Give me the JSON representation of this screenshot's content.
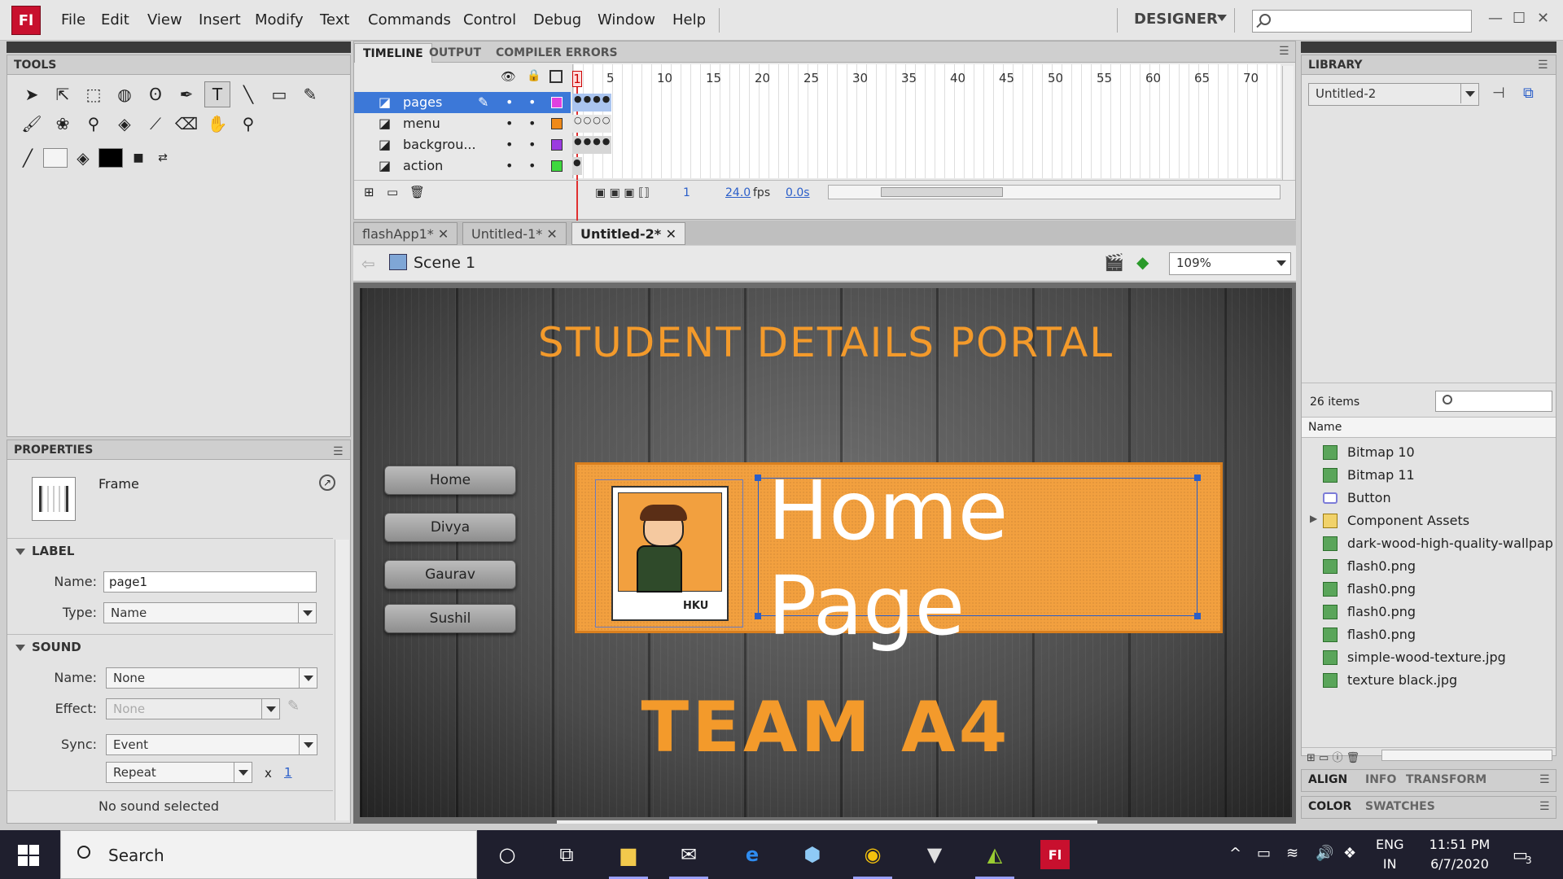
{
  "app": {
    "logo": "Fl",
    "workspace": "DESIGNER"
  },
  "menu": [
    "File",
    "Edit",
    "View",
    "Insert",
    "Modify",
    "Text",
    "Commands",
    "Control",
    "Debug",
    "Window",
    "Help"
  ],
  "panels": {
    "tools": "TOOLS",
    "properties": "PROPERTIES",
    "library": "LIBRARY"
  },
  "properties": {
    "type_label": "Frame",
    "label_section": "LABEL",
    "name_label": "Name:",
    "name_value": "page1",
    "type_field_label": "Type:",
    "type_value": "Name",
    "sound_section": "SOUND",
    "sound_name_label": "Name:",
    "sound_name_value": "None",
    "effect_label": "Effect:",
    "effect_value": "None",
    "sync_label": "Sync:",
    "sync_value": "Event",
    "repeat_value": "Repeat",
    "repeat_x": "x",
    "repeat_count": "1",
    "status": "No sound selected"
  },
  "timeline": {
    "tabs": [
      "TIMELINE",
      "OUTPUT",
      "COMPILER ERRORS"
    ],
    "layers": [
      "pages",
      "menu",
      "backgrou...",
      "action"
    ],
    "layer_colors": [
      "#e040e0",
      "#f08a1a",
      "#9b3ce0",
      "#3ed83e"
    ],
    "frame_numbers": [
      "1",
      "5",
      "10",
      "15",
      "20",
      "25",
      "30",
      "35",
      "40",
      "45",
      "50",
      "55",
      "60",
      "65",
      "70"
    ],
    "current_frame": "1",
    "fps": "24.0",
    "fps_unit": "fps",
    "time": "0.0s"
  },
  "documents": [
    "flashApp1*",
    "Untitled-1*",
    "Untitled-2*"
  ],
  "scene": {
    "name": "Scene 1",
    "zoom": "109%"
  },
  "stage": {
    "title": "STUDENT DETAILS PORTAL",
    "buttons": [
      "Home",
      "Divya",
      "Gaurav",
      "Sushil"
    ],
    "heading": "Home Page",
    "photo_badge": "HKU",
    "team": "TEAM A4"
  },
  "library": {
    "document": "Untitled-2",
    "count": "26 items",
    "column": "Name",
    "items": [
      {
        "name": "Bitmap 10",
        "kind": "bitmap"
      },
      {
        "name": "Bitmap 11",
        "kind": "bitmap"
      },
      {
        "name": "Button",
        "kind": "button"
      },
      {
        "name": "Component Assets",
        "kind": "folder"
      },
      {
        "name": "dark-wood-high-quality-wallpap",
        "kind": "bitmap"
      },
      {
        "name": "flash0.png",
        "kind": "bitmap"
      },
      {
        "name": "flash0.png",
        "kind": "bitmap"
      },
      {
        "name": "flash0.png",
        "kind": "bitmap"
      },
      {
        "name": "flash0.png",
        "kind": "bitmap"
      },
      {
        "name": "simple-wood-texture.jpg",
        "kind": "bitmap"
      },
      {
        "name": "texture black.jpg",
        "kind": "bitmap"
      }
    ]
  },
  "bottom_tabs": {
    "row1": [
      "ALIGN",
      "INFO",
      "TRANSFORM"
    ],
    "row2": [
      "COLOR",
      "SWATCHES"
    ]
  },
  "taskbar": {
    "search": "Search",
    "lang1": "ENG",
    "lang2": "IN",
    "time": "11:51 PM",
    "date": "6/7/2020",
    "notifications": "3"
  }
}
